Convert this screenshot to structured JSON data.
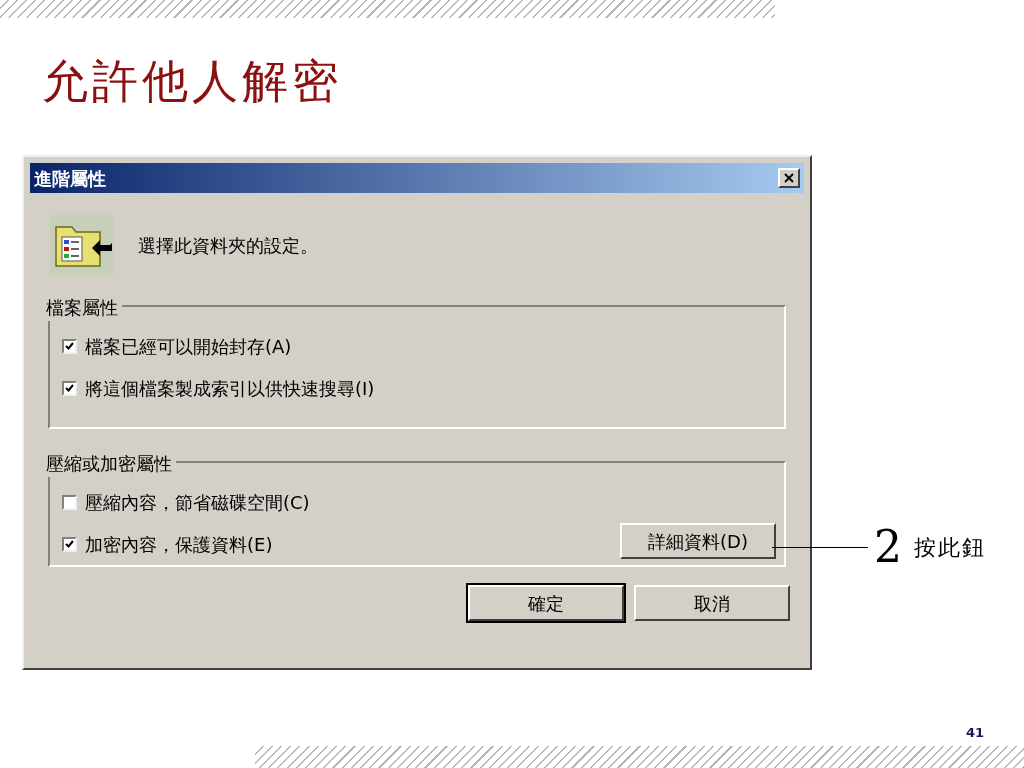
{
  "slide": {
    "title": "允許他人解密",
    "page_number": "41"
  },
  "dialog": {
    "title": "進階屬性",
    "description": "選擇此資料夾的設定。",
    "groups": [
      {
        "title": "檔案屬性",
        "options": [
          {
            "label": "檔案已經可以開始封存(A)",
            "checked": true
          },
          {
            "label": "將這個檔案製成索引以供快速搜尋(I)",
            "checked": true
          }
        ]
      },
      {
        "title": "壓縮或加密屬性",
        "options": [
          {
            "label": "壓縮內容，節省磁碟空間(C)",
            "checked": false
          },
          {
            "label": "加密內容，保護資料(E)",
            "checked": true
          }
        ],
        "button": "詳細資料(D)"
      }
    ],
    "buttons": [
      {
        "label": "確定",
        "default": true
      },
      {
        "label": "取消",
        "default": false
      }
    ]
  },
  "callout": {
    "number": "2",
    "text": "按此鈕"
  }
}
